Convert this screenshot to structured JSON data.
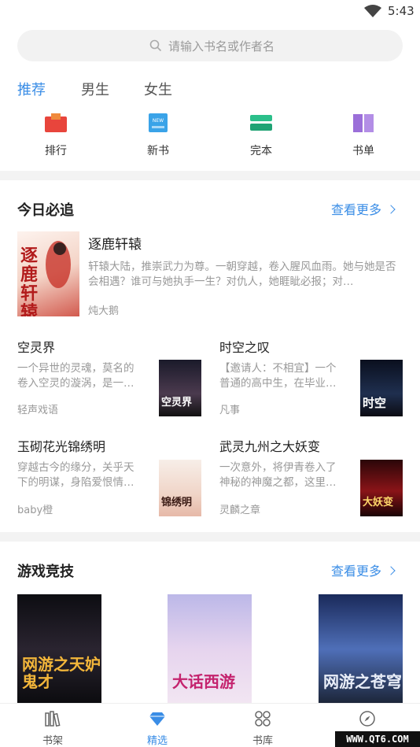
{
  "status_bar": {
    "time": "5:43",
    "wifi_icon": "wifi-icon"
  },
  "search": {
    "placeholder": "请输入书名或作者名",
    "icon": "search-icon"
  },
  "tabs": [
    {
      "label": "推荐",
      "active": true
    },
    {
      "label": "男生",
      "active": false
    },
    {
      "label": "女生",
      "active": false
    }
  ],
  "categories": [
    {
      "label": "排行",
      "icon": "ranking-icon",
      "color": "#e8453c"
    },
    {
      "label": "新书",
      "icon": "new-book-icon",
      "color": "#3aa3e8"
    },
    {
      "label": "完本",
      "icon": "finished-book-icon",
      "color": "#2bbf8a"
    },
    {
      "label": "书单",
      "icon": "booklist-icon",
      "color": "#9b6fd9"
    }
  ],
  "section_today": {
    "title": "今日必追",
    "more": "查看更多",
    "featured": {
      "title": "逐鹿轩辕",
      "cover_text": "逐鹿轩辕",
      "desc": "轩辕大陆，推崇武力为尊。一朝穿越，卷入腥风血雨。她与她是否会相遇？谁可与她执手一生？对仇人，她睚眦必报；对…",
      "author": "炖大鹅"
    },
    "books": [
      {
        "title": "空灵界",
        "desc": "一个异世的灵魂，莫名的卷入空灵的漩涡，是一…",
        "author": "轻声戏语",
        "cover_text": "空灵界"
      },
      {
        "title": "时空之叹",
        "desc": "【邀请人：不相宜】一个普通的高中生，在毕业…",
        "author": "凡事",
        "cover_text": "时空"
      },
      {
        "title": "玉砌花光锦绣明",
        "desc": "穿越古今的缘分，关乎天下的明谋，身陷爱恨情…",
        "author": "baby橙",
        "cover_text": "锦绣明"
      },
      {
        "title": "武灵九州之大妖变",
        "desc": "一次意外，将伊青卷入了神秘的神魔之都，这里…",
        "author": "灵麟之章",
        "cover_text": "大妖变"
      }
    ]
  },
  "section_games": {
    "title": "游戏竞技",
    "more": "查看更多",
    "covers": [
      {
        "cover_text": "网游之天妒鬼才"
      },
      {
        "cover_text": "大话西游"
      },
      {
        "cover_text": "网游之苍穹"
      }
    ]
  },
  "bottom_nav": [
    {
      "label": "书架",
      "icon": "bookshelf-icon",
      "active": false
    },
    {
      "label": "精选",
      "icon": "diamond-icon",
      "active": true
    },
    {
      "label": "书库",
      "icon": "library-grid-icon",
      "active": false
    },
    {
      "label": "",
      "icon": "compass-icon",
      "active": false
    }
  ],
  "watermark": "WWW.QT6.COM",
  "colors": {
    "accent": "#3a8de6",
    "divider": "#f3f3f3",
    "muted_text": "#999999"
  }
}
